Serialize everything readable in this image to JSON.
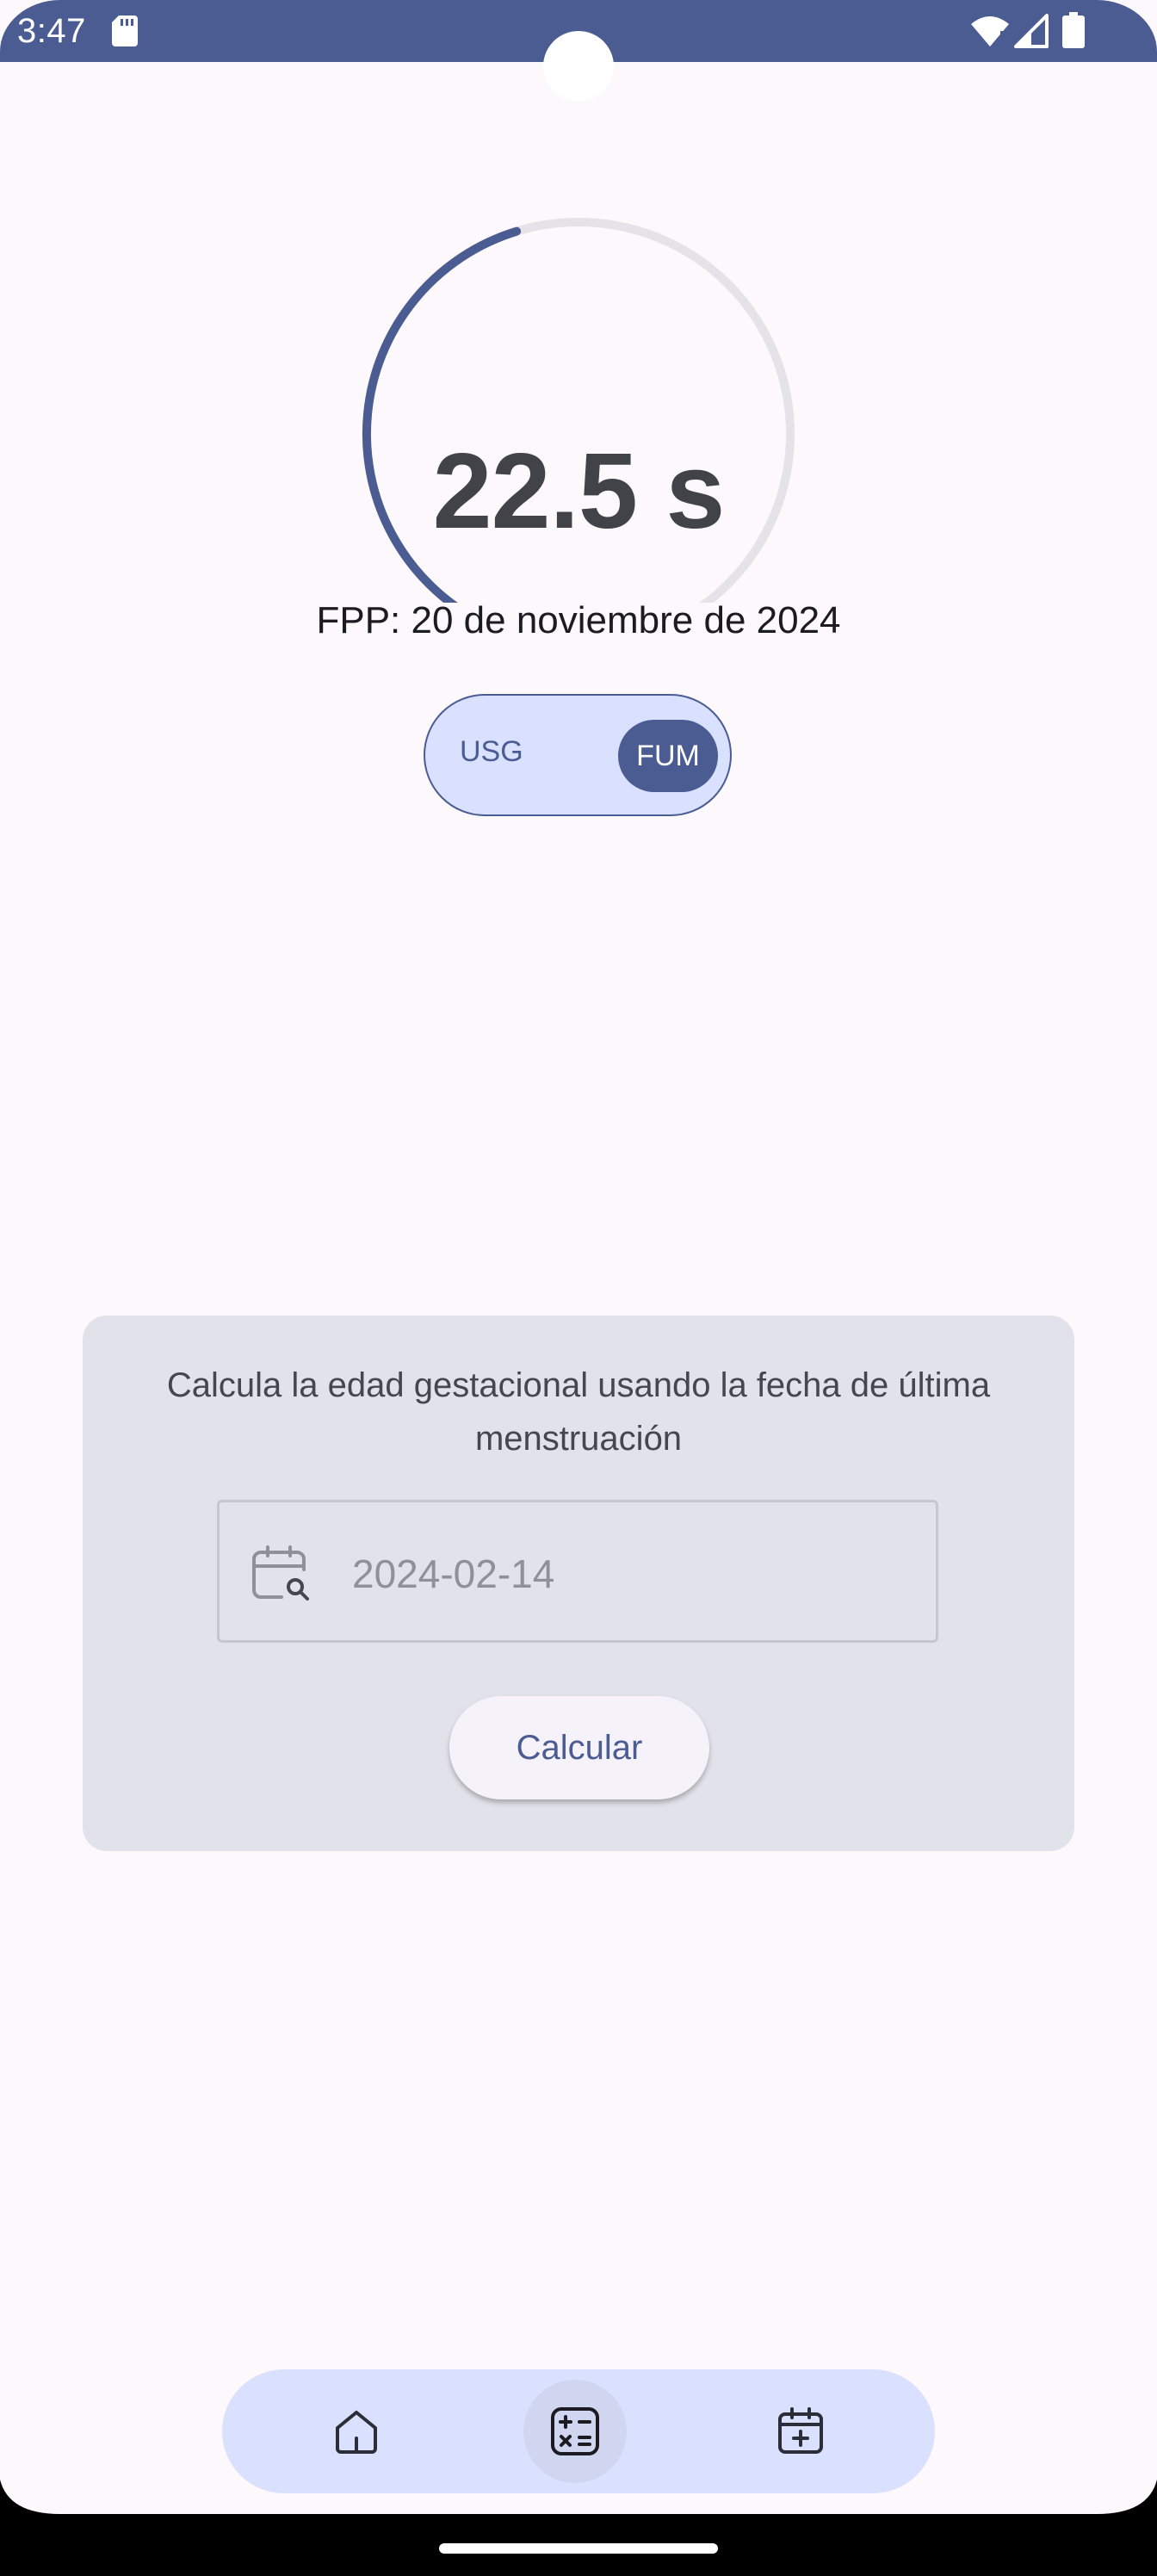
{
  "status_bar": {
    "time": "3:47",
    "color": "#4a5c92",
    "icons": [
      "sd-card-icon",
      "wifi-icon",
      "signal-icon",
      "battery-icon"
    ]
  },
  "gauge": {
    "value": "22.5 s",
    "progress_fraction": 0.45,
    "track_color": "#e6e3e8",
    "fill_color": "#4a5c92"
  },
  "due_date": "FPP: 20 de noviembre de 2024",
  "toggle": {
    "options": [
      "USG",
      "FUM"
    ],
    "selected": "FUM"
  },
  "card": {
    "description": "Calcula la edad gestacional usando la fecha de última menstruación",
    "date_field": {
      "value": "2024-02-14",
      "icon": "calendar-search-icon"
    },
    "button_label": "Calcular"
  },
  "bottom_nav": {
    "items": [
      {
        "icon": "home-icon",
        "selected": false
      },
      {
        "icon": "calculator-icon",
        "selected": true
      },
      {
        "icon": "calendar-add-icon",
        "selected": false
      }
    ]
  }
}
